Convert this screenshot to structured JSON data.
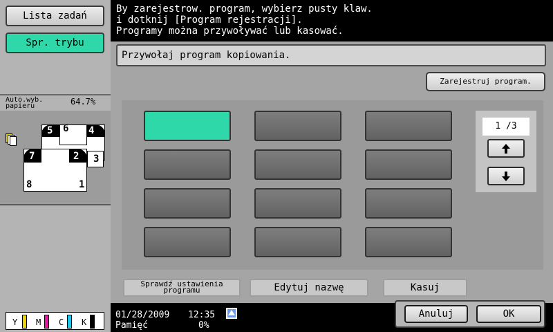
{
  "left_panel": {
    "job_list_label": "Lista zadań",
    "mode_check_label": "Spr. trybu",
    "auto_paper_line1": "Auto.wyb.",
    "auto_paper_line2": "papieru",
    "zoom": "64.7%",
    "preview_numbers": [
      "5",
      "6",
      "4",
      "7",
      "2",
      "3",
      "8",
      "1"
    ],
    "toner": [
      {
        "label": "Y",
        "color": "#e6d200"
      },
      {
        "label": "M",
        "color": "#e0189c"
      },
      {
        "label": "C",
        "color": "#1ec8e8"
      },
      {
        "label": "K",
        "color": "#000000"
      }
    ]
  },
  "message": {
    "line1": "By zarejestrow. program, wybierz pusty klaw.",
    "line2": "i dotknij [Program rejestracji].",
    "line3": "Programy można przywoływać lub kasować."
  },
  "panel": {
    "title": "Przywołaj program kopiowania.",
    "register_label": "Zarejestruj program.",
    "page_indicator": "1 /3",
    "check_settings_line1": "Sprawdź ustawienia",
    "check_settings_line2": "programu",
    "edit_name_label": "Edytuj nazwę",
    "delete_label": "Kasuj"
  },
  "footer": {
    "cancel_label": "Anuluj",
    "ok_label": "OK",
    "date": "01/28/2009",
    "time": "12:35",
    "memory_label": "Pamięć",
    "memory_value": "0%"
  },
  "colors": {
    "accent": "#2fd8a8"
  }
}
